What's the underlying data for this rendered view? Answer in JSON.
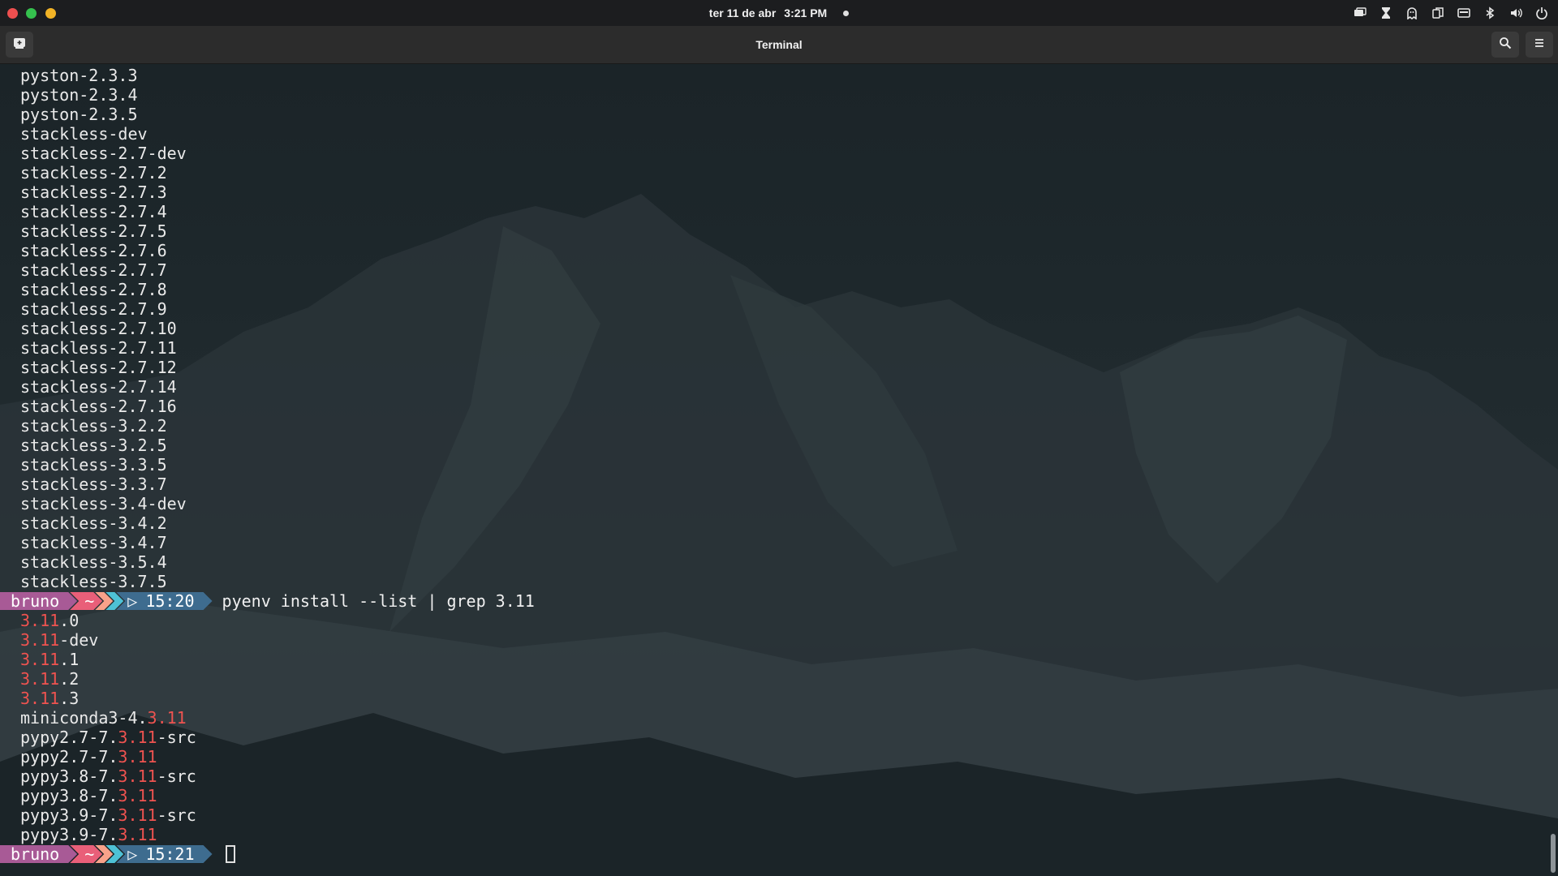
{
  "topbar": {
    "date": "ter 11 de abr",
    "time": "3:21 PM",
    "tray_icons": [
      "window-switcher-icon",
      "hourglass-icon",
      "ghost-icon",
      "copy-icon",
      "keyboard-icon",
      "bluetooth-icon",
      "volume-icon",
      "power-icon"
    ]
  },
  "window": {
    "title": "Terminal",
    "buttons": [
      "new-tab-icon",
      "search-icon",
      "hamburger-menu-icon"
    ]
  },
  "terminal": {
    "output_lines": [
      "pyston-2.3.3",
      "pyston-2.3.4",
      "pyston-2.3.5",
      "stackless-dev",
      "stackless-2.7-dev",
      "stackless-2.7.2",
      "stackless-2.7.3",
      "stackless-2.7.4",
      "stackless-2.7.5",
      "stackless-2.7.6",
      "stackless-2.7.7",
      "stackless-2.7.8",
      "stackless-2.7.9",
      "stackless-2.7.10",
      "stackless-2.7.11",
      "stackless-2.7.12",
      "stackless-2.7.14",
      "stackless-2.7.16",
      "stackless-3.2.2",
      "stackless-3.2.5",
      "stackless-3.3.5",
      "stackless-3.3.7",
      "stackless-3.4-dev",
      "stackless-3.4.2",
      "stackless-3.4.7",
      "stackless-3.5.4",
      "stackless-3.7.5"
    ],
    "prompt1": {
      "user": "bruno",
      "dir": "~",
      "time": "15:20",
      "command": "pyenv install --list | grep 3.11"
    },
    "grep_results": [
      {
        "pre": "",
        "match": "3.11",
        "post": ".0"
      },
      {
        "pre": "",
        "match": "3.11",
        "post": "-dev"
      },
      {
        "pre": "",
        "match": "3.11",
        "post": ".1"
      },
      {
        "pre": "",
        "match": "3.11",
        "post": ".2"
      },
      {
        "pre": "",
        "match": "3.11",
        "post": ".3"
      },
      {
        "pre": "miniconda3-4.",
        "match": "3.11",
        "post": ""
      },
      {
        "pre": "pypy2.7-7.",
        "match": "3.11",
        "post": "-src"
      },
      {
        "pre": "pypy2.7-7.",
        "match": "3.11",
        "post": ""
      },
      {
        "pre": "pypy3.8-7.",
        "match": "3.11",
        "post": "-src"
      },
      {
        "pre": "pypy3.8-7.",
        "match": "3.11",
        "post": ""
      },
      {
        "pre": "pypy3.9-7.",
        "match": "3.11",
        "post": "-src"
      },
      {
        "pre": "pypy3.9-7.",
        "match": "3.11",
        "post": ""
      }
    ],
    "prompt2": {
      "user": "bruno",
      "dir": "~",
      "time": "15:21",
      "command": ""
    },
    "match_color": "#ef5350",
    "prompt_colors": {
      "user": "#a85a96",
      "dir": "#e95f79",
      "chevron1": "#f8a28a",
      "chevron2": "#4ec2d6",
      "time": "#3e6c8f"
    }
  }
}
